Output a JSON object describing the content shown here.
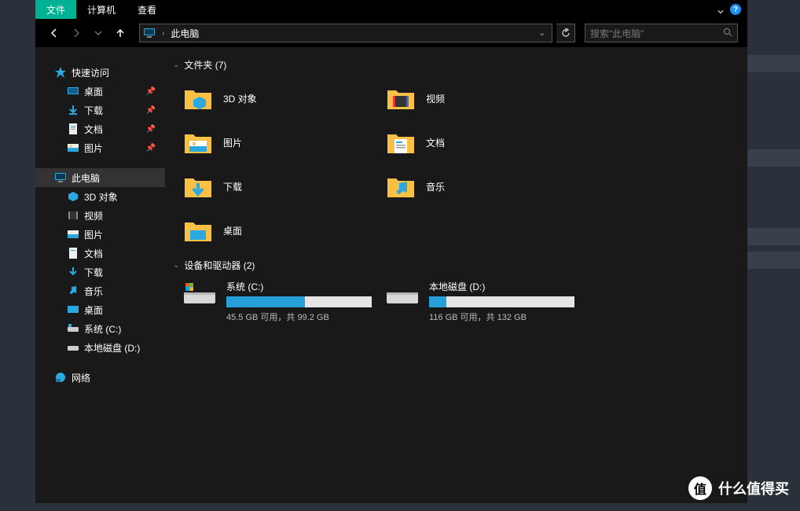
{
  "ribbon": {
    "tabs": [
      "文件",
      "计算机",
      "查看"
    ],
    "active_index": 0
  },
  "address": {
    "location": "此电脑"
  },
  "search": {
    "placeholder": "搜索\"此电脑\""
  },
  "sidebar": {
    "quick_access": {
      "label": "快速访问",
      "items": [
        {
          "label": "桌面",
          "icon": "desktop",
          "pinned": true
        },
        {
          "label": "下载",
          "icon": "downloads",
          "pinned": true
        },
        {
          "label": "文档",
          "icon": "documents",
          "pinned": true
        },
        {
          "label": "图片",
          "icon": "pictures",
          "pinned": true
        }
      ]
    },
    "this_pc": {
      "label": "此电脑",
      "items": [
        {
          "label": "3D 对象",
          "icon": "3d"
        },
        {
          "label": "视频",
          "icon": "videos"
        },
        {
          "label": "图片",
          "icon": "pictures"
        },
        {
          "label": "文档",
          "icon": "documents"
        },
        {
          "label": "下载",
          "icon": "downloads"
        },
        {
          "label": "音乐",
          "icon": "music"
        },
        {
          "label": "桌面",
          "icon": "desktop"
        },
        {
          "label": "系统 (C:)",
          "icon": "drive"
        },
        {
          "label": "本地磁盘 (D:)",
          "icon": "drive"
        }
      ]
    },
    "network": {
      "label": "网络"
    }
  },
  "groups": {
    "folders": {
      "header": "文件夹 (7)",
      "items": [
        {
          "label": "3D 对象",
          "icon": "3d"
        },
        {
          "label": "视频",
          "icon": "videos"
        },
        {
          "label": "图片",
          "icon": "pictures"
        },
        {
          "label": "文档",
          "icon": "documents"
        },
        {
          "label": "下载",
          "icon": "downloads"
        },
        {
          "label": "音乐",
          "icon": "music"
        },
        {
          "label": "桌面",
          "icon": "desktop"
        }
      ]
    },
    "drives": {
      "header": "设备和驱动器 (2)",
      "items": [
        {
          "name": "系统 (C:)",
          "free_text": "45.5 GB 可用，共 99.2 GB",
          "used_pct": 54,
          "os": true
        },
        {
          "name": "本地磁盘 (D:)",
          "free_text": "116 GB 可用，共 132 GB",
          "used_pct": 12,
          "os": false
        }
      ]
    }
  },
  "watermark": {
    "badge": "值",
    "text": "什么值得买"
  }
}
